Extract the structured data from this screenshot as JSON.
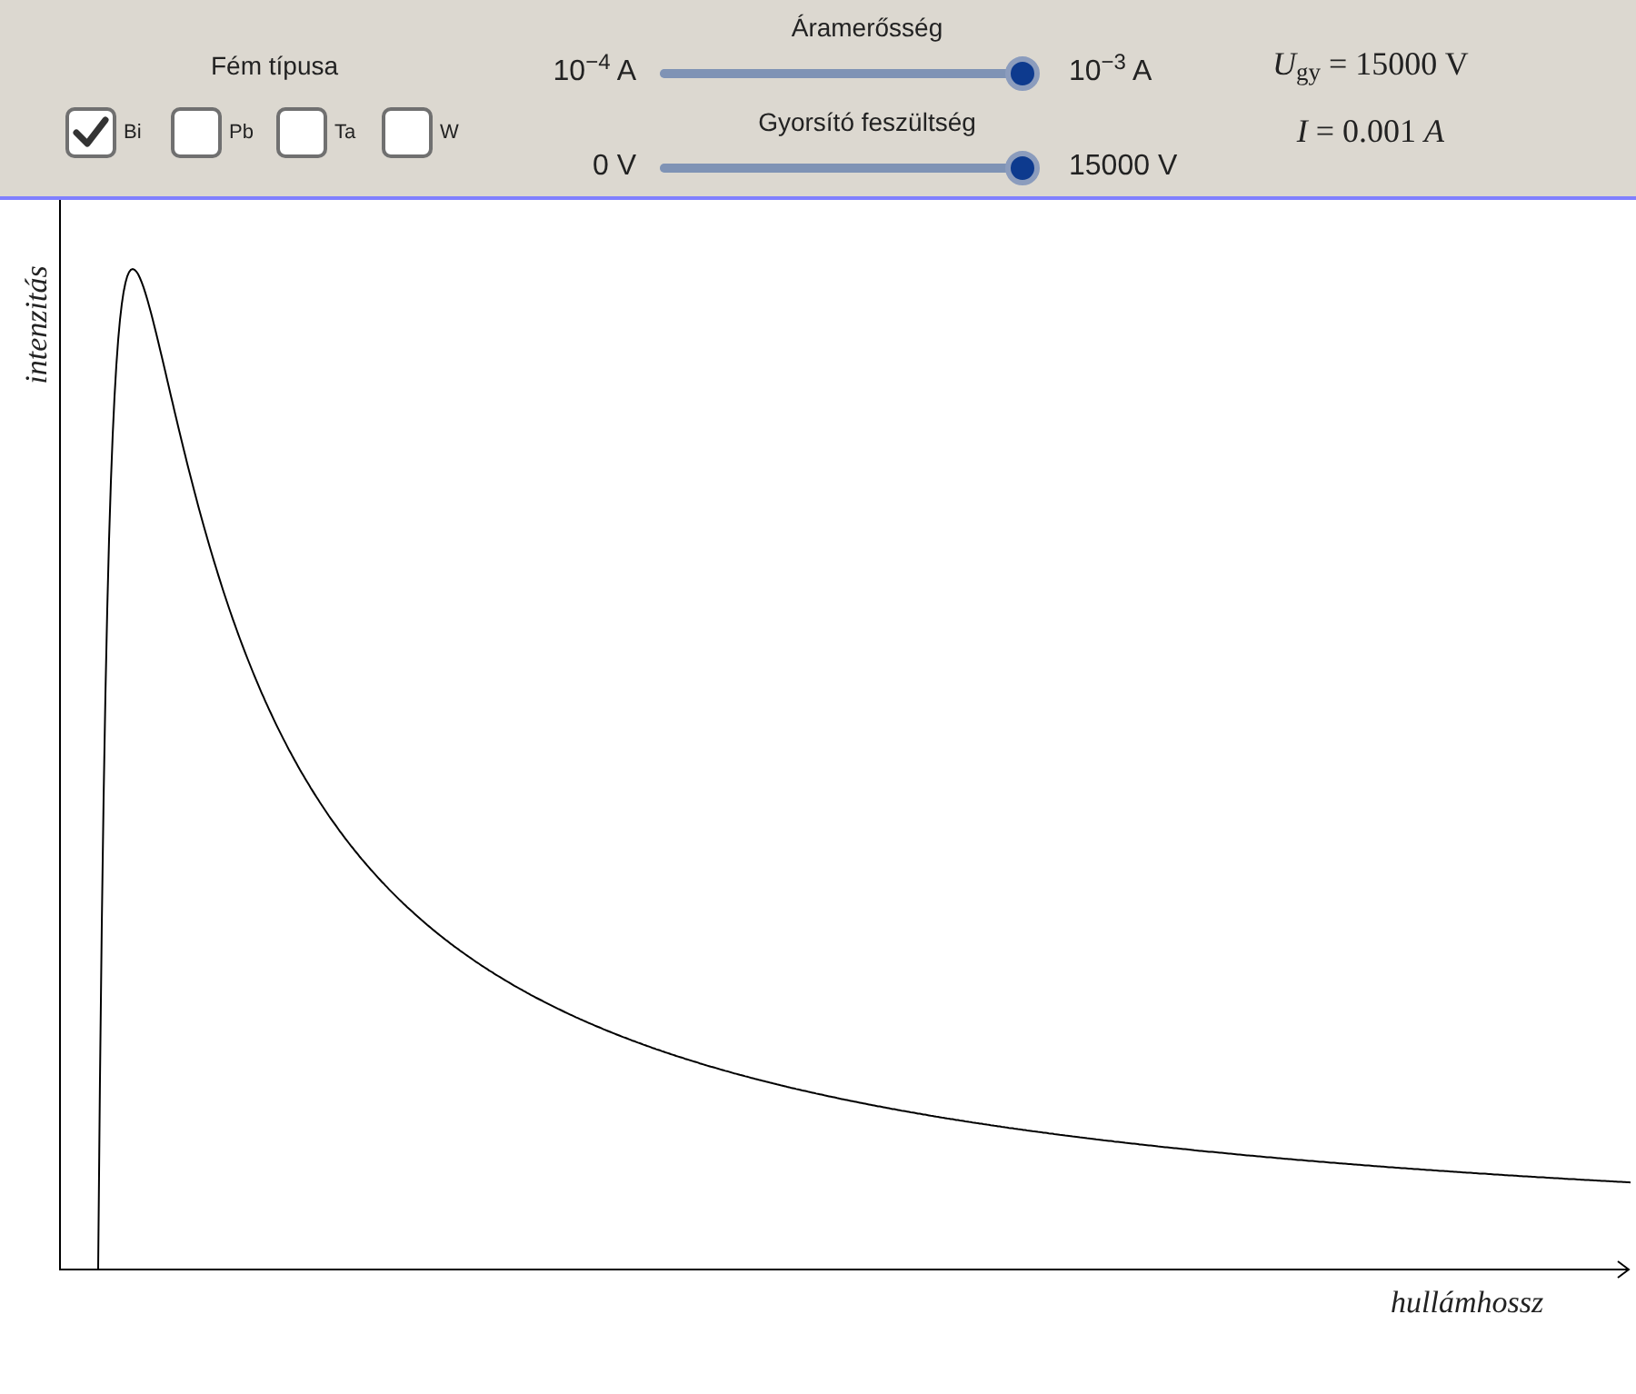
{
  "metal": {
    "title": "Fém típusa",
    "options": [
      {
        "label": "Bi",
        "checked": true
      },
      {
        "label": "Pb",
        "checked": false
      },
      {
        "label": "Ta",
        "checked": false
      },
      {
        "label": "W",
        "checked": false
      }
    ]
  },
  "sliders": [
    {
      "title": "Áramerősség",
      "min": "10$^{−4}$ A",
      "max": "10$^{−3}$ A",
      "level": 1
    },
    {
      "title": "Gyorsító feszültség",
      "min": "0 V",
      "max": "15000 V",
      "level": 1
    }
  ],
  "readouts": [
    "*U*$_{gy}$ = 15000 V",
    "*I* = 0.001 *A*"
  ],
  "plot": {
    "ylabel": "intenzitás",
    "xlabel": "hullámhossz"
  }
}
